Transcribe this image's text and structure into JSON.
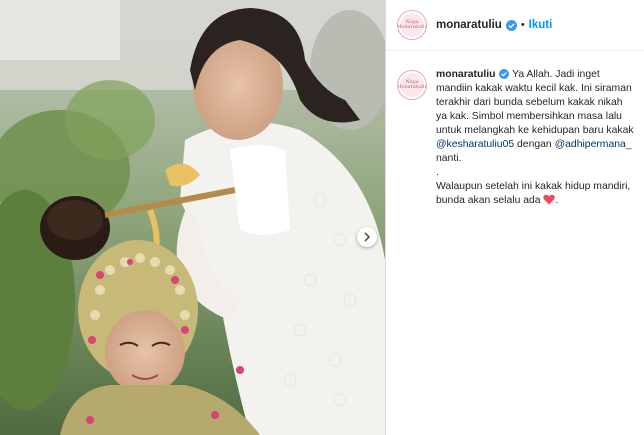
{
  "post": {
    "username": "monaratuliu",
    "follow_label": "Ikuti",
    "separator": "•",
    "avatar_logo_text": "Naya Monaratuliu",
    "caption": {
      "part1": " Ya Allah. Jadi inget mandiin kakak waktu kecil kak. Ini siraman terakhir dari bunda sebelum kakak nikah ya kak. Simbol membersihkan masa lalu untuk melangkah ke kehidupan baru kakak ",
      "mention1": "@kesharatuliu05",
      "part2": " dengan ",
      "mention2": "@adhipermana_",
      "part3": " nanti.",
      "dot_line": ".",
      "part4": "Walaupun setelah ini kakak hidup mandiri, bunda akan selalu ada "
    }
  },
  "colors": {
    "verified": "#3897f0",
    "link": "#00376b",
    "follow": "#0095f6",
    "heart": "#ed4956"
  },
  "icons": {
    "verified": "verified-badge-icon",
    "next": "chevron-right-icon",
    "heart": "heart-emoji-icon"
  }
}
